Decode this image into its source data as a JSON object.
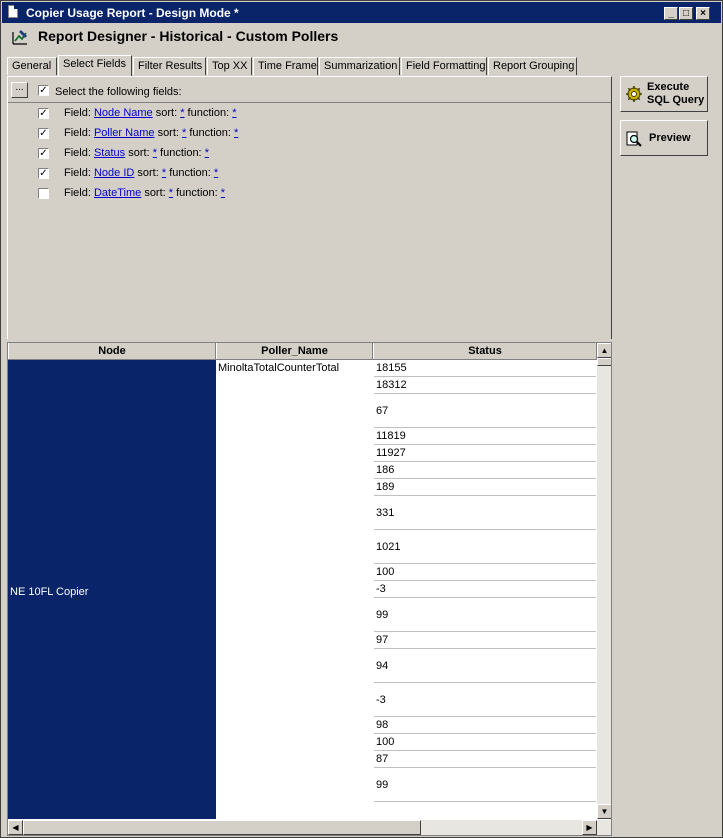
{
  "window": {
    "title": "Copier Usage Report - Design Mode *",
    "minimize": "_",
    "maximize": "□",
    "close": "×"
  },
  "header": {
    "title": "Report Designer - Historical - Custom Pollers"
  },
  "tabs": [
    "General",
    "Select Fields",
    "Filter Results",
    "Top XX",
    "Time Frame",
    "Summarization",
    "Field Formatting",
    "Report Grouping"
  ],
  "active_tab": "Select Fields",
  "select_fields": {
    "ellipsis": "...",
    "all_checked": true,
    "header_text": "Select the following fields:",
    "field_prefix": "Field:",
    "sort_label": "sort:",
    "function_label": "function:",
    "fields": [
      {
        "name": "Node Name",
        "checked": true,
        "sort": "*",
        "function": "*"
      },
      {
        "name": "Poller Name",
        "checked": true,
        "sort": "*",
        "function": "*"
      },
      {
        "name": "Status",
        "checked": true,
        "sort": "*",
        "function": "*"
      },
      {
        "name": "Node ID",
        "checked": true,
        "sort": "*",
        "function": "*"
      },
      {
        "name": "DateTime",
        "checked": false,
        "sort": "*",
        "function": "*"
      }
    ]
  },
  "side_buttons": {
    "execute": "Execute\nSQL Query",
    "preview": "Preview"
  },
  "grid": {
    "columns": [
      "Node",
      "Poller_Name",
      "Status"
    ],
    "node_value": "NE 10FL Copier",
    "poller_value": "MinoltaTotalCounterTotal",
    "status_values": [
      "18155",
      "18312",
      "67",
      "11819",
      "11927",
      "186",
      "189",
      "331",
      "1021",
      "100",
      "-3",
      "99",
      "97",
      "94",
      "-3",
      "98",
      "100",
      "87",
      "99"
    ],
    "selection_color": "#0a246a"
  }
}
